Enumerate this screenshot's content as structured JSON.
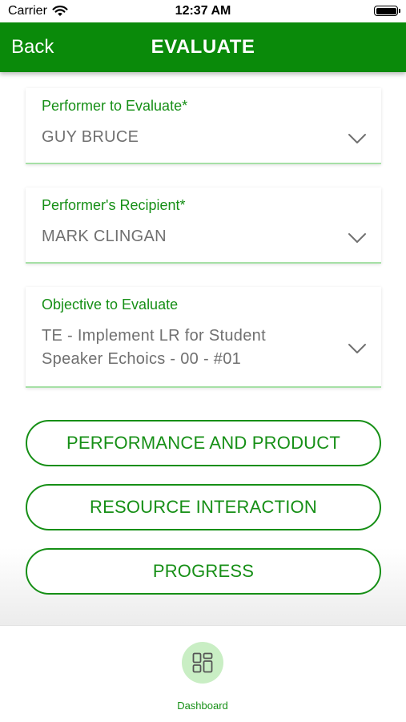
{
  "status_bar": {
    "carrier": "Carrier",
    "time": "12:37 AM"
  },
  "navbar": {
    "back_label": "Back",
    "title": "EVALUATE"
  },
  "fields": {
    "performer": {
      "label": "Performer to Evaluate*",
      "value": "GUY BRUCE"
    },
    "recipient": {
      "label": "Performer's Recipient*",
      "value": "MARK CLINGAN"
    },
    "objective": {
      "label": "Objective to Evaluate",
      "value_line1": "TE - Implement LR for Student",
      "value_line2": "Speaker Echoics - 00 - #01"
    }
  },
  "buttons": {
    "performance": "PERFORMANCE AND PRODUCT",
    "resource": "RESOURCE INTERACTION",
    "progress": "PROGRESS"
  },
  "tab_bar": {
    "dashboard_label": "Dashboard"
  },
  "colors": {
    "brand_green": "#0a8a0a",
    "label_green": "#168f16",
    "value_gray": "#707070",
    "underline_green": "#a6e0a6",
    "icon_bg_green": "#c9eec4"
  },
  "icons": {
    "wifi": "wifi-icon",
    "battery": "battery-icon",
    "chevron": "chevron-down-icon",
    "dashboard": "dashboard-grid-icon"
  }
}
